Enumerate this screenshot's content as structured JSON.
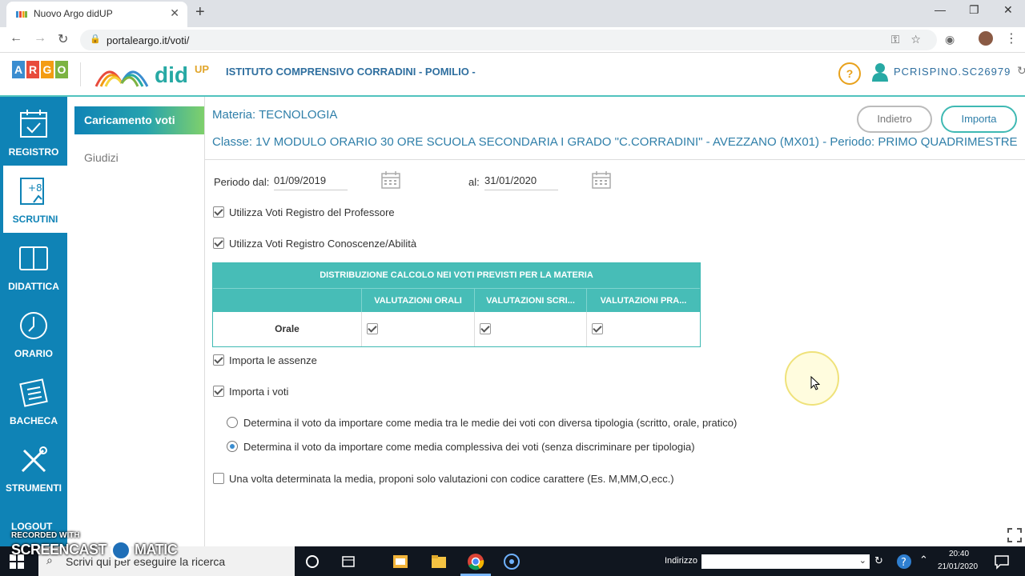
{
  "browser": {
    "tab_title": "Nuovo Argo didUP",
    "url": "portaleargo.it/voti/"
  },
  "header": {
    "argo_letters": [
      "A",
      "R",
      "G",
      "O"
    ],
    "argo_colors": [
      "#3a8dd0",
      "#e84b3c",
      "#f39c12",
      "#7cb342"
    ],
    "product": "did",
    "product_sup": "UP",
    "school": "ISTITUTO COMPRENSIVO CORRADINI - POMILIO -",
    "help": "?",
    "user": "PCRISPINO.SC26979"
  },
  "nav": {
    "items": [
      {
        "label": "REGISTRO",
        "icon": "calendar-check-icon"
      },
      {
        "label": "SCRUTINI",
        "icon": "scrutini-icon",
        "active": true
      },
      {
        "label": "DIDATTICA",
        "icon": "book-icon"
      },
      {
        "label": "ORARIO",
        "icon": "clock-icon"
      },
      {
        "label": "BACHECA",
        "icon": "board-icon"
      },
      {
        "label": "STRUMENTI",
        "icon": "tools-icon"
      }
    ],
    "logout": "LOGOUT"
  },
  "submenu": {
    "caricamento": "Caricamento voti",
    "giudizi": "Giudizi"
  },
  "content": {
    "materia": "Materia: TECNOLOGIA",
    "classe": "Classe: 1V MODULO ORARIO 30 ORE SCUOLA SECONDARIA I GRADO \"C.CORRADINI\" - AVEZZANO (MX01) - Periodo: PRIMO QUADRIMESTRE",
    "btn_indietro": "Indietro",
    "btn_importa": "Importa"
  },
  "form": {
    "periodo_label": "Periodo dal:",
    "periodo_dal": "01/09/2019",
    "al_label": "al:",
    "periodo_al": "31/01/2020",
    "chk_registro_prof": {
      "label": "Utilizza Voti Registro del Professore",
      "checked": true
    },
    "chk_registro_conosc": {
      "label": "Utilizza Voti Registro Conoscenze/Abilità",
      "checked": true
    },
    "chk_assenze": {
      "label": "Importa le assenze",
      "checked": true
    },
    "chk_voti": {
      "label": "Importa i voti",
      "checked": true
    },
    "radio_tipologia": {
      "label": "Determina il voto da importare come media tra le medie dei voti con diversa tipologia (scritto, orale, pratico)",
      "selected": false
    },
    "radio_complessiva": {
      "label": "Determina il voto da importare come media complessiva dei voti (senza discriminare per tipologia)",
      "selected": true
    },
    "chk_codice": {
      "label": "Una volta determinata la media, proponi solo valutazioni con codice carattere (Es. M,MM,O,ecc.)",
      "checked": false
    }
  },
  "table": {
    "title": "DISTRIBUZIONE CALCOLO NEI VOTI PREVISTI PER LA MATERIA",
    "columns": [
      "VALUTAZIONI ORALI",
      "VALUTAZIONI SCRI...",
      "VALUTAZIONI PRA..."
    ],
    "rows": [
      {
        "label": "Orale",
        "checks": [
          true,
          true,
          true
        ]
      }
    ]
  },
  "taskbar": {
    "search_placeholder": "Scrivi qui per eseguire la ricerca",
    "address_label": "Indirizzo",
    "time": "20:40",
    "date": "21/01/2020"
  },
  "watermark": {
    "line1": "RECORDED WITH",
    "line2": "SCREENCAST",
    "line3": "MATIC"
  }
}
